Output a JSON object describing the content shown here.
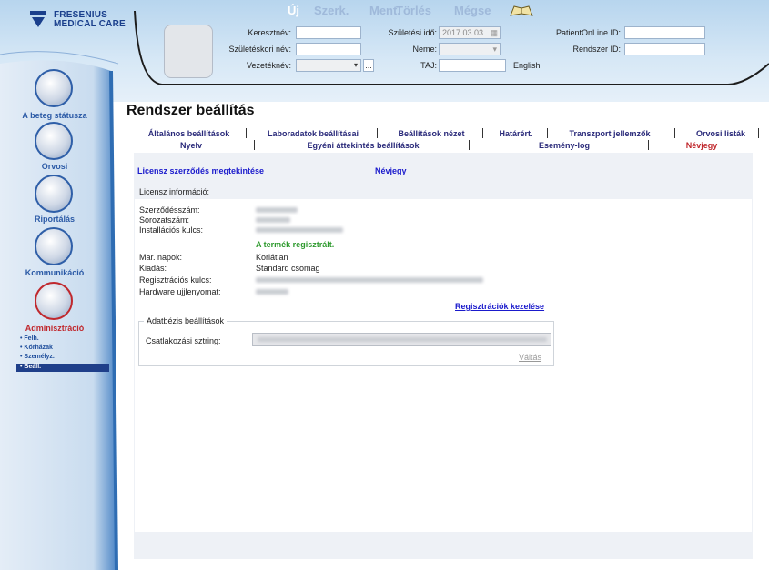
{
  "brand": {
    "line1": "FRESENIUS",
    "line2": "MEDICAL CARE"
  },
  "toolbar": {
    "new": "Új",
    "edit": "Szerk.",
    "save": "Ment.",
    "delete": "Törlés",
    "cancel": "Mégse"
  },
  "patient": {
    "first_name_label": "Keresztnév:",
    "birth_name_label": "Születéskori név:",
    "last_name_label": "Vezetéknév:",
    "birth_date_label": "Születési idő:",
    "birth_date_value": "2017.03.03.",
    "gender_label": "Neme:",
    "taj_label": "TAJ:",
    "language": "English",
    "pol_id_label": "PatientOnLine ID:",
    "system_id_label": "Rendszer ID:",
    "browse_btn": "..."
  },
  "sidebar": {
    "items": [
      {
        "label": "A beteg státusza"
      },
      {
        "label": "Orvosi"
      },
      {
        "label": "Riportálás"
      },
      {
        "label": "Kommunikáció"
      },
      {
        "label": "Adminisztráció"
      }
    ],
    "sub": [
      "Felh.",
      "Kórházak",
      "Személyz.",
      "Beáll."
    ]
  },
  "page": {
    "title": "Rendszer beállítás"
  },
  "tabs_row1": [
    "Általános beállítások",
    "Laboradatok beállításai",
    "Beállítások nézet",
    "Határért.",
    "Transzport jellemzők",
    "Orvosi listák"
  ],
  "tabs_row2": [
    "Nyelv",
    "Egyéni áttekintés beállítások",
    "Esemény-log",
    "Névjegy"
  ],
  "links": {
    "license": "Licensz szerződés megtekintése",
    "about": "Névjegy"
  },
  "license": {
    "section_title": "Licensz információ:",
    "contract_no": "Szerződésszám:",
    "serial_no": "Sorozatszám:",
    "install_key": "Installációs kulcs:",
    "registered_msg": "A termék regisztrált.",
    "days_left_label": "Mar. napok:",
    "days_left_value": "Korlátlan",
    "edition_label": "Kiadás:",
    "edition_value": "Standard csomag",
    "reg_key_label": "Regisztrációs kulcs:",
    "hw_fingerprint_label": "Hardware ujjlenyomat:",
    "manage_link": "Regisztrációk kezelése"
  },
  "database": {
    "legend": "Adatbézis beállítások",
    "conn_label": "Csatlakozási sztring:",
    "switch_btn": "Váltás"
  },
  "colors": {
    "accent": "#1a3f8c",
    "active_tab": "#c0282d",
    "registered": "#2e9a2e",
    "link": "#1a1acc"
  }
}
